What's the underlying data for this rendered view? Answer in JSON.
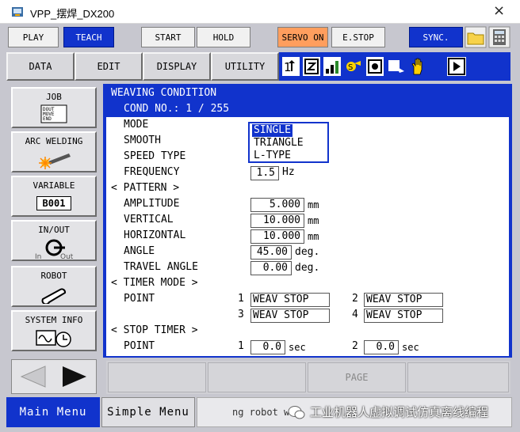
{
  "window": {
    "title": "VPP_摆焊_DX200",
    "close_glyph": "×"
  },
  "top_buttons": {
    "play": "PLAY",
    "teach": "TEACH",
    "start": "START",
    "hold": "HOLD",
    "servo_on": "SERVO ON",
    "estop": "E.STOP",
    "sync": "SYNC."
  },
  "menu": {
    "data": "DATA",
    "edit": "EDIT",
    "display": "DISPLAY",
    "utility": "UTILITY"
  },
  "nav": {
    "job": {
      "label": "JOB",
      "icon_text": "DOUT\nMOVE\nEND"
    },
    "arc_welding": {
      "label": "ARC WELDING"
    },
    "variable": {
      "label": "VARIABLE",
      "icon_text": "B001"
    },
    "in_out": {
      "label": "IN/OUT",
      "in": "In",
      "out": "Out"
    },
    "robot": {
      "label": "ROBOT"
    },
    "system_info": {
      "label": "SYSTEM INFO"
    }
  },
  "content": {
    "header_title": "WEAVING CONDITION",
    "cond_no": "COND NO.: 1 / 255",
    "rows": {
      "mode": "MODE",
      "smooth": "SMOOTH",
      "speed_type": "SPEED TYPE",
      "frequency": "FREQUENCY",
      "pattern": "< PATTERN >",
      "amplitude": "AMPLITUDE",
      "vertical": "VERTICAL",
      "horizontal": "HORIZONTAL",
      "angle": "ANGLE",
      "travel_angle": "TRAVEL ANGLE",
      "timer_mode": "< TIMER MODE >",
      "point": "POINT",
      "stop_timer": "< STOP TIMER >",
      "point2": "POINT"
    },
    "values": {
      "frequency": "1.5",
      "frequency_unit": "Hz",
      "amplitude": "5.000",
      "amplitude_unit": "mm",
      "vertical": "10.000",
      "vertical_unit": "mm",
      "horizontal": "10.000",
      "horizontal_unit": "mm",
      "angle": "45.00",
      "angle_unit": "deg.",
      "travel_angle": "0.00",
      "travel_angle_unit": "deg."
    },
    "timer_points": [
      {
        "num": "1",
        "value": "WEAV STOP"
      },
      {
        "num": "2",
        "value": "WEAV STOP"
      },
      {
        "num": "3",
        "value": "WEAV STOP"
      },
      {
        "num": "4",
        "value": "WEAV STOP"
      }
    ],
    "stop_timer_points": [
      {
        "num": "1",
        "value": "0.0",
        "unit": "sec"
      },
      {
        "num": "2",
        "value": "0.0",
        "unit": "sec"
      }
    ]
  },
  "popup": {
    "options": [
      "SINGLE",
      "TRIANGLE",
      "L-TYPE"
    ],
    "selected": "SINGLE"
  },
  "bottom": {
    "page": "PAGE"
  },
  "status": {
    "main_menu": "Main Menu",
    "simple_menu": "Simple Menu",
    "message": "ng robot wr",
    "watermark": "工业机器人虚拟调试仿真离线编程"
  }
}
